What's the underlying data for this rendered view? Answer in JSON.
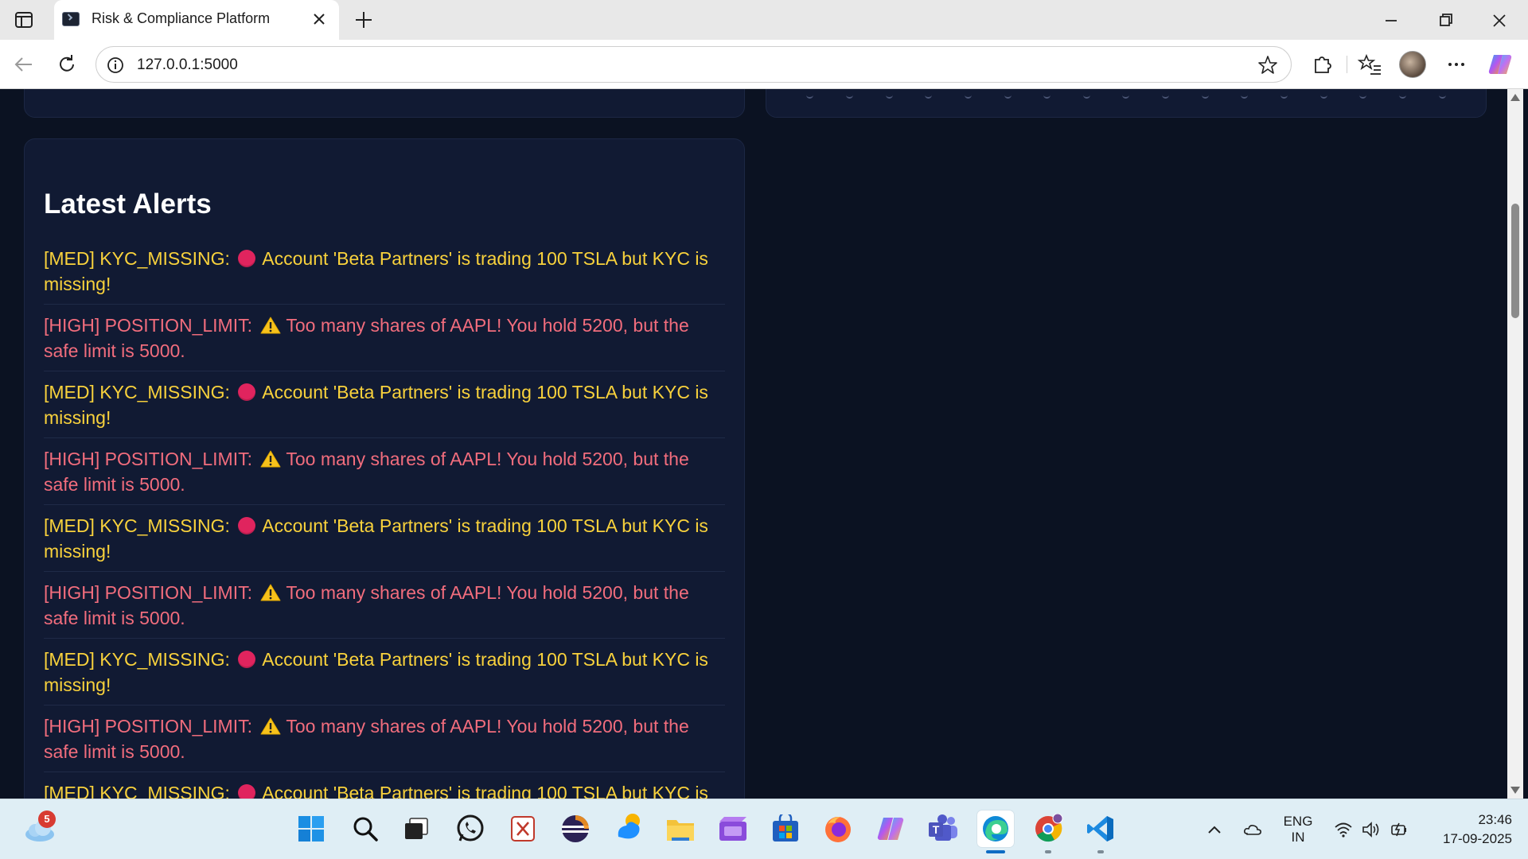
{
  "browser": {
    "tab_title": "Risk & Compliance Platform",
    "url": "127.0.0.1:5000"
  },
  "alerts_panel": {
    "title": "Latest Alerts",
    "alerts": [
      {
        "level": "MED",
        "prefix": "[MED] KYC_MISSING:",
        "icon": "red-circle-icon",
        "message": "Account 'Beta Partners' is trading 100 TSLA but KYC is missing!"
      },
      {
        "level": "HIGH",
        "prefix": "[HIGH] POSITION_LIMIT:",
        "icon": "warning-icon",
        "message": "Too many shares of AAPL! You hold 5200, but the safe limit is 5000."
      },
      {
        "level": "MED",
        "prefix": "[MED] KYC_MISSING:",
        "icon": "red-circle-icon",
        "message": "Account 'Beta Partners' is trading 100 TSLA but KYC is missing!"
      },
      {
        "level": "HIGH",
        "prefix": "[HIGH] POSITION_LIMIT:",
        "icon": "warning-icon",
        "message": "Too many shares of AAPL! You hold 5200, but the safe limit is 5000."
      },
      {
        "level": "MED",
        "prefix": "[MED] KYC_MISSING:",
        "icon": "red-circle-icon",
        "message": "Account 'Beta Partners' is trading 100 TSLA but KYC is missing!"
      },
      {
        "level": "HIGH",
        "prefix": "[HIGH] POSITION_LIMIT:",
        "icon": "warning-icon",
        "message": "Too many shares of AAPL! You hold 5200, but the safe limit is 5000."
      },
      {
        "level": "MED",
        "prefix": "[MED] KYC_MISSING:",
        "icon": "red-circle-icon",
        "message": "Account 'Beta Partners' is trading 100 TSLA but KYC is missing!"
      },
      {
        "level": "HIGH",
        "prefix": "[HIGH] POSITION_LIMIT:",
        "icon": "warning-icon",
        "message": "Too many shares of AAPL! You hold 5200, but the safe limit is 5000."
      },
      {
        "level": "MED",
        "prefix": "[MED] KYC_MISSING:",
        "icon": "red-circle-icon",
        "message": "Account 'Beta Partners' is trading 100 TSLA but KYC is"
      }
    ]
  },
  "taskbar": {
    "weather_badge": "5",
    "language_line1": "ENG",
    "language_line2": "IN",
    "time": "23:46",
    "date": "17-09-2025",
    "apps": [
      "windows-start-icon",
      "search-icon",
      "task-view-icon",
      "whatsapp-icon",
      "file-explorer-icon",
      "eclipse-icon",
      "weather-app-icon",
      "folder-icon",
      "video-editor-icon",
      "microsoft-store-icon",
      "firefox-icon",
      "copilot-icon",
      "teams-icon",
      "edge-icon",
      "chrome-icon",
      "vscode-icon"
    ]
  },
  "colors": {
    "page_bg": "#0b1222",
    "card_bg": "#111a33",
    "med_alert": "#f9d23c",
    "high_alert": "#f26d7d"
  }
}
